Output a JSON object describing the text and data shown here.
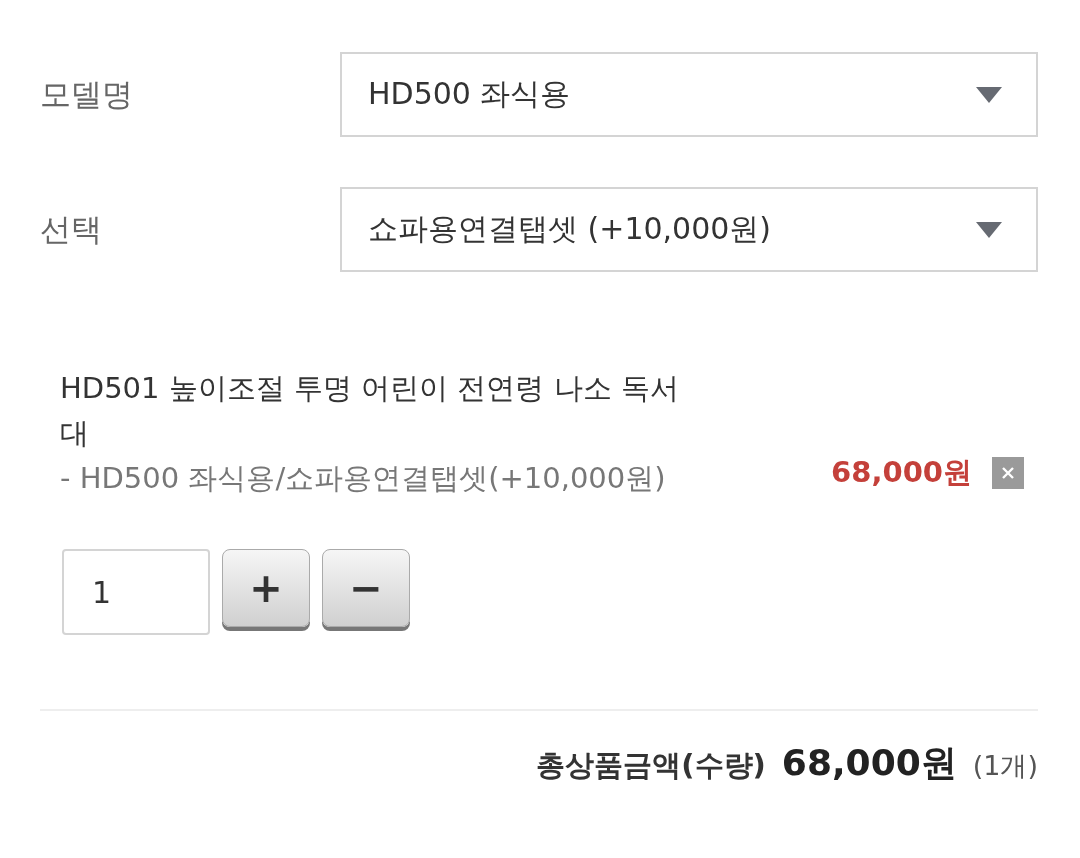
{
  "options": [
    {
      "label": "모델명",
      "value": "HD500 좌식용"
    },
    {
      "label": "선택",
      "value": "쇼파용연결탭셋 (+10,000원)"
    }
  ],
  "selected_item": {
    "name": "HD501 높이조절 투명 어린이 전연령 나소 독서대",
    "option": "- HD500 좌식용/쇼파용연결탭셋(+10,000원)",
    "price": "68,000원",
    "quantity": "1",
    "plus": "+",
    "minus": "−"
  },
  "total": {
    "label": "총상품금액(수량)",
    "amount": "68,000원",
    "count": "(1개)"
  }
}
